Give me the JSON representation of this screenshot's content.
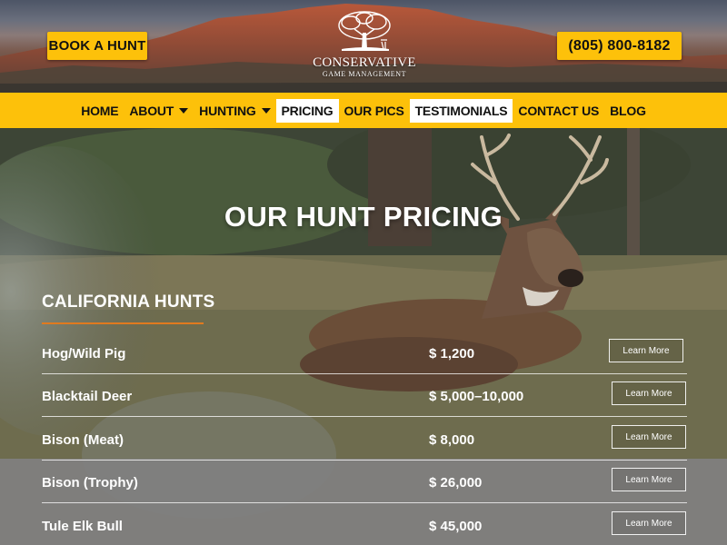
{
  "header": {
    "book_button": "BOOK A HUNT",
    "phone": "(805) 800-8182",
    "logo": {
      "name": "CONSERVATIVE",
      "subtitle": "GAME MANAGEMENT",
      "icon": "oak-tree-deer-icon"
    }
  },
  "nav": [
    {
      "label": "HOME",
      "dropdown": false,
      "active": false
    },
    {
      "label": "ABOUT",
      "dropdown": true,
      "active": false
    },
    {
      "label": "HUNTING",
      "dropdown": true,
      "active": false
    },
    {
      "label": "PRICING",
      "dropdown": false,
      "active": true
    },
    {
      "label": "OUR PICS",
      "dropdown": false,
      "active": false
    },
    {
      "label": "TESTIMONIALS",
      "dropdown": false,
      "active": true
    },
    {
      "label": "CONTACT US",
      "dropdown": false,
      "active": false
    },
    {
      "label": "BLOG",
      "dropdown": false,
      "active": false
    }
  ],
  "hero": {
    "title": "OUR HUNT PRICING"
  },
  "section": {
    "title": "CALIFORNIA HUNTS"
  },
  "hunts": [
    {
      "name": "Hog/Wild Pig",
      "price": "$ 1,200",
      "cta": "Learn More"
    },
    {
      "name": "Blacktail Deer",
      "price": "$ 5,000–10,000",
      "cta": "Learn More"
    },
    {
      "name": "Bison (Meat)",
      "price": "$ 8,000",
      "cta": "Learn More"
    },
    {
      "name": "Bison (Trophy)",
      "price": "$ 26,000",
      "cta": "Learn More"
    },
    {
      "name": "Tule Elk Bull",
      "price": "$ 45,000",
      "cta": "Learn More"
    }
  ],
  "colors": {
    "accent_yellow": "#fdc10a",
    "underline_orange": "#e07a1f"
  }
}
